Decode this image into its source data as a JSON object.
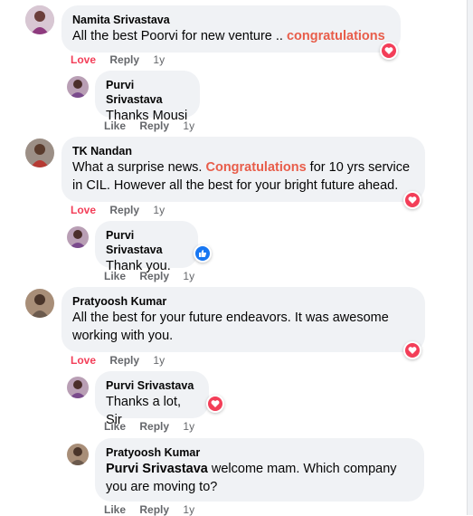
{
  "colors": {
    "highlight": "#e85d4a",
    "love": "#f33e58",
    "like": "#1877f2",
    "bubble": "#f0f2f5",
    "meta": "#65676b"
  },
  "comments": [
    {
      "name": "Namita Srivastava",
      "text_pre": "All the best Poorvi for new venture .. ",
      "text_hl": "congratulations",
      "actions": {
        "reaction": "Love",
        "reply": "Reply",
        "age": "1y"
      },
      "reaction_icon": "heart-icon"
    },
    {
      "name": "Purvi Srivastava",
      "text": "Thanks Mousi",
      "actions": {
        "reaction": "Like",
        "reply": "Reply",
        "age": "1y"
      }
    },
    {
      "name": "TK Nandan",
      "text_pre": "What a surprise news. ",
      "text_hl": "Congratulations",
      "text_post": " for 10 yrs service",
      "text_line2": "in CIL. However all the best for your bright future ahead.",
      "actions": {
        "reaction": "Love",
        "reply": "Reply",
        "age": "1y"
      },
      "reaction_icon": "heart-icon"
    },
    {
      "name": "Purvi Srivastava",
      "text": "Thank you.",
      "actions": {
        "reaction": "Like",
        "reply": "Reply",
        "age": "1y"
      },
      "reaction_icon": "thumbs-up-icon"
    },
    {
      "name": "Pratyoosh Kumar",
      "text_line1": "All the best for your future endeavors. It was awesome",
      "text_line2": "working with you.",
      "actions": {
        "reaction": "Love",
        "reply": "Reply",
        "age": "1y"
      },
      "reaction_icon": "heart-icon"
    },
    {
      "name": "Purvi Srivastava",
      "text": "Thanks a lot, Sir",
      "actions": {
        "reaction": "Like",
        "reply": "Reply",
        "age": "1y"
      },
      "reaction_icon": "heart-icon"
    },
    {
      "name": "Pratyoosh Kumar",
      "tag": "Purvi Srivastava",
      "text_post": " welcome mam. Which company",
      "text_line2": "you are moving to?",
      "actions": {
        "reaction": "Like",
        "reply": "Reply",
        "age": "1y"
      }
    }
  ]
}
